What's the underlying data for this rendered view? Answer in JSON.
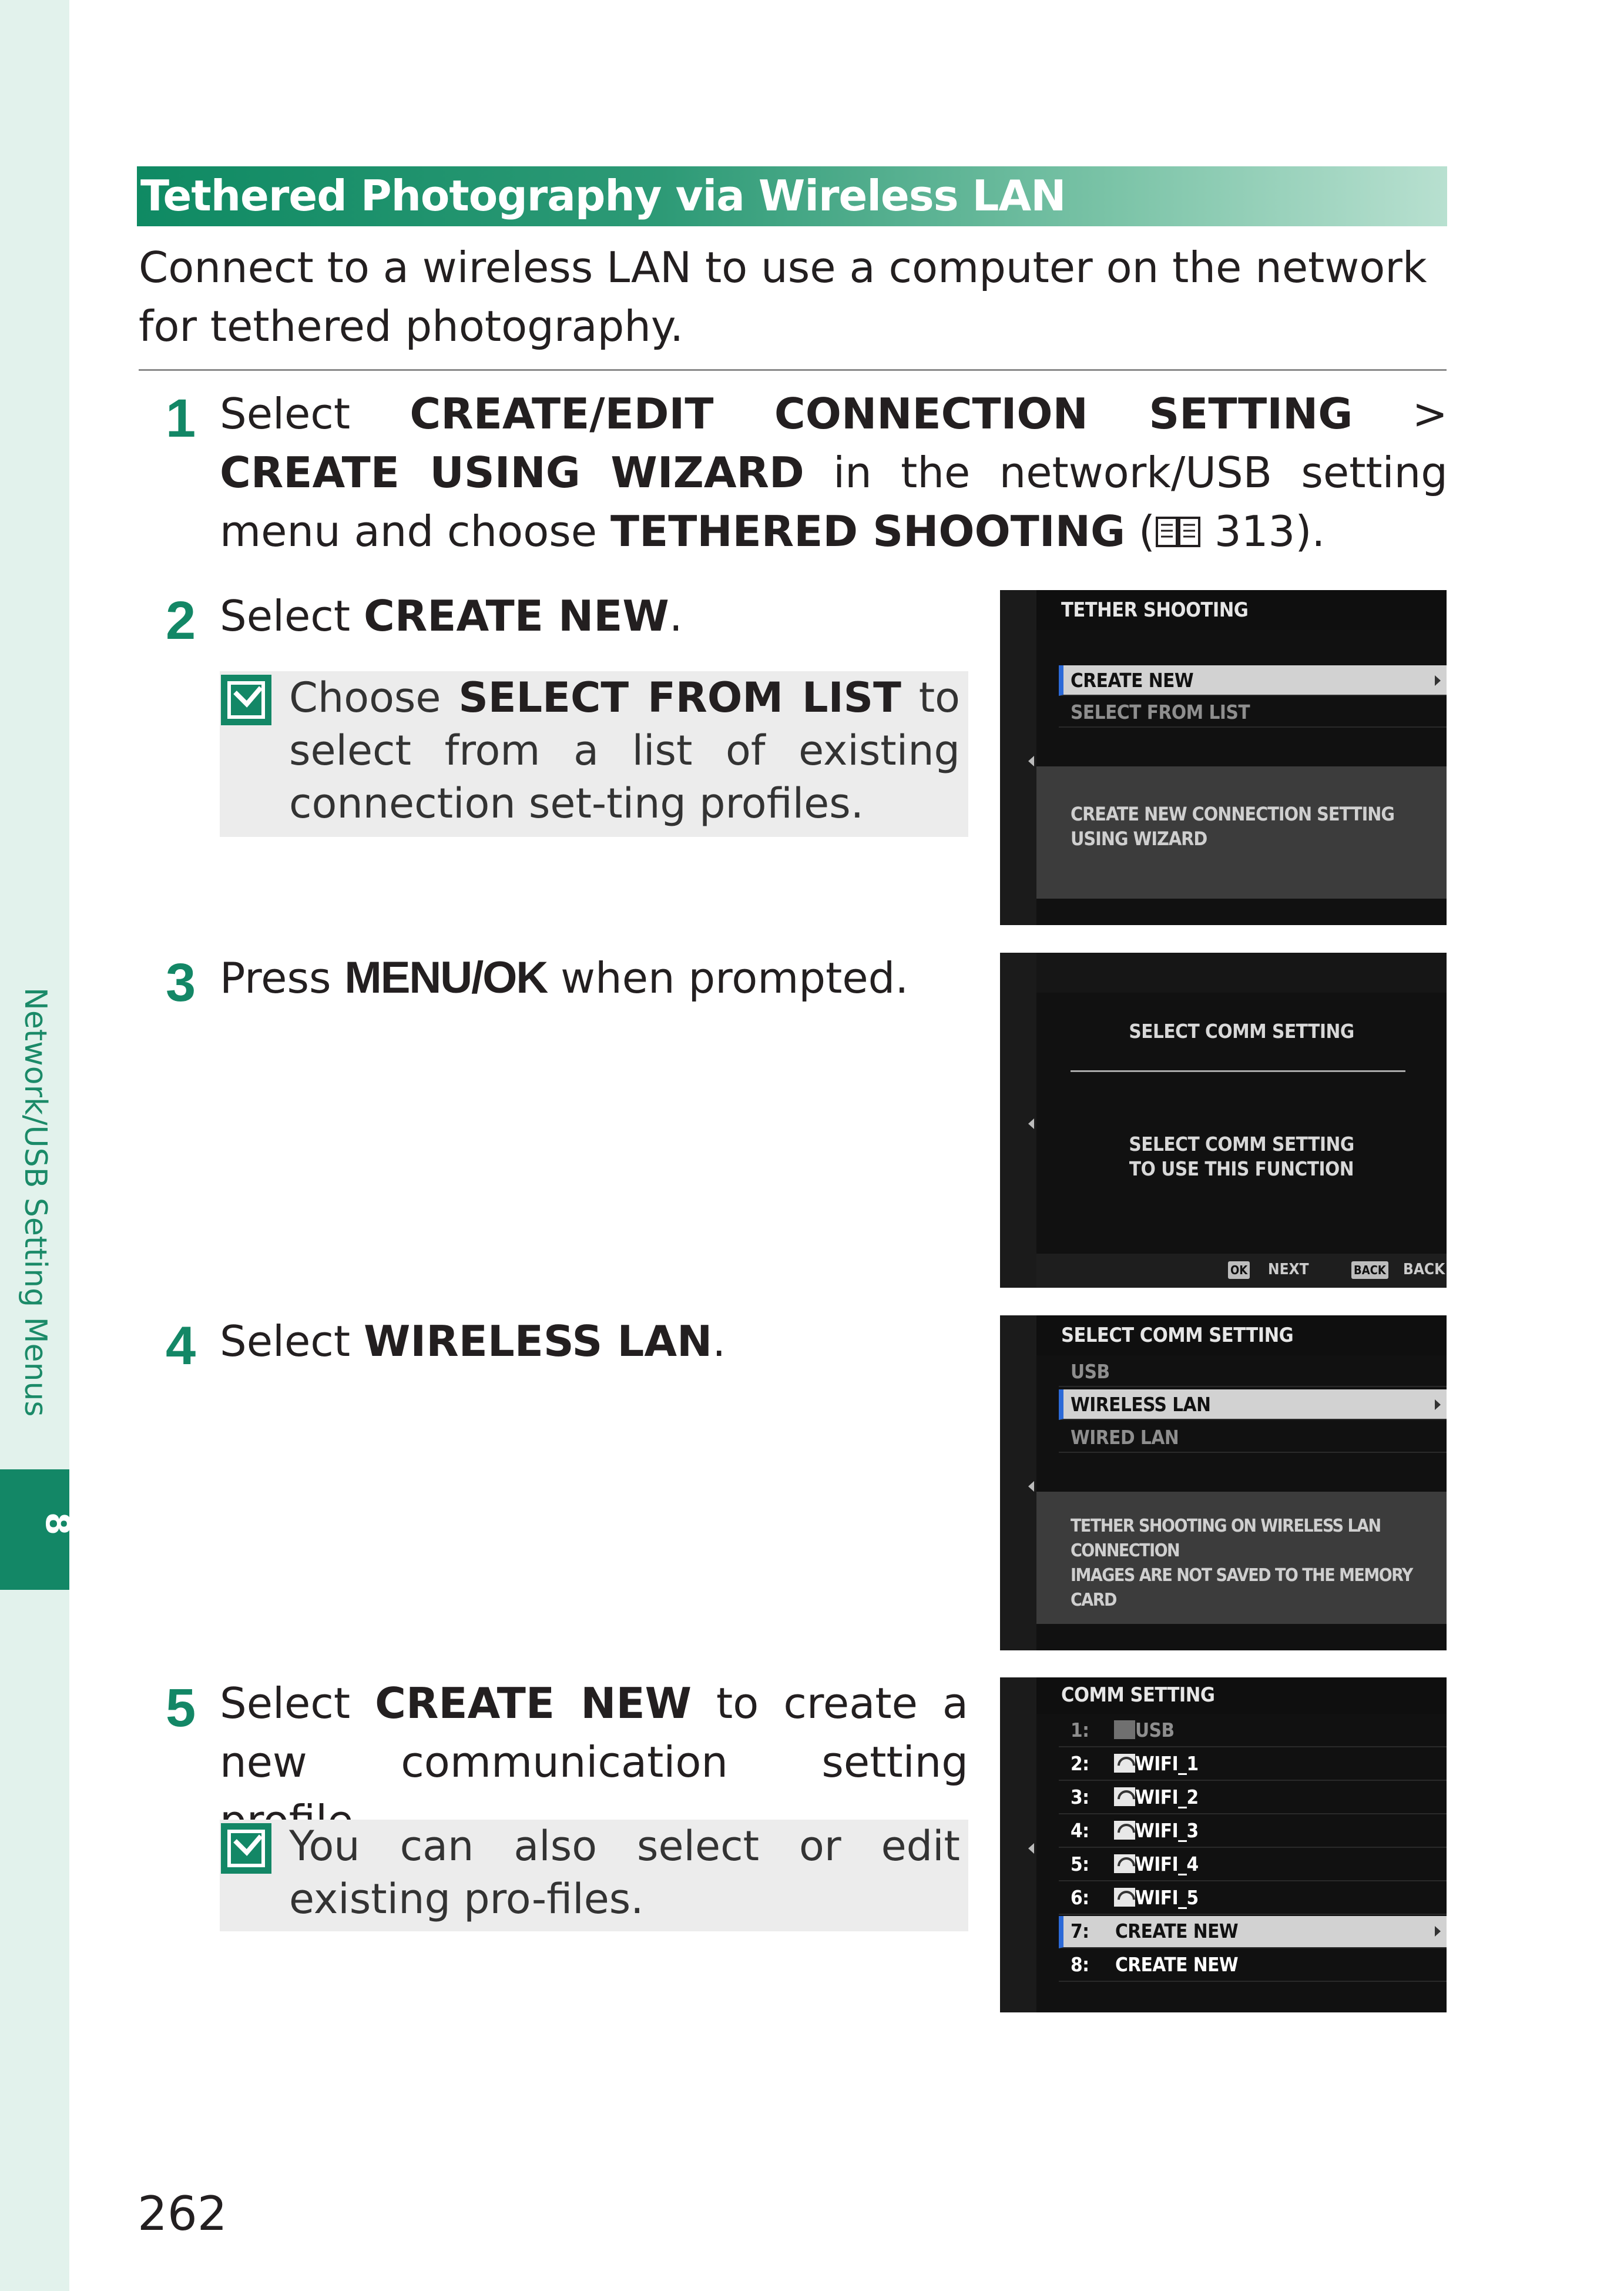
{
  "sidebar": {
    "chapter_label": "Network/USB Setting Menus",
    "chapter_number": "8"
  },
  "section": {
    "title": "Tethered Photography via Wireless LAN",
    "intro": "Connect to a wireless LAN to use a computer on the network for tethered photography."
  },
  "steps": {
    "s1": {
      "num": "1",
      "t1": "Select ",
      "b1": "CREATE/EDIT CONNECTION SETTING",
      "t2": " > ",
      "b2": "CREATE USING WIZARD",
      "t3": " in the network/USB setting menu and choose ",
      "b3": "TETHERED SHOOTING",
      "t4": " (",
      "t5": " 313)."
    },
    "s2": {
      "num": "2",
      "t1": "Select ",
      "b1": "CREATE NEW",
      "t2": "."
    },
    "s2_note": {
      "t1": "Choose ",
      "b1": "SELECT FROM LIST",
      "t2": " to select from a list of existing connection set-ting profiles."
    },
    "s3": {
      "num": "3",
      "t1": "Press ",
      "b1": "MENU/OK",
      "t2": " when prompted."
    },
    "s4": {
      "num": "4",
      "t1": "Select ",
      "b1": "WIRELESS LAN",
      "t2": "."
    },
    "s5": {
      "num": "5",
      "t1": "Select ",
      "b1": "CREATE NEW",
      "t2": " to create a new communication setting profile."
    },
    "s5_note": {
      "text": "You can also select or edit existing pro-files."
    }
  },
  "screens": {
    "scr1": {
      "title": "TETHER SHOOTING",
      "rows": [
        "CREATE NEW",
        "SELECT FROM LIST"
      ],
      "desc1": "CREATE NEW CONNECTION SETTING",
      "desc2": "USING WIZARD"
    },
    "scr2": {
      "title": "SELECT COMM SETTING",
      "msg1": "SELECT COMM SETTING",
      "msg2": "TO USE THIS FUNCTION",
      "ok_btn": "OK",
      "next": "NEXT",
      "back_btn": "BACK",
      "back": "BACK"
    },
    "scr3": {
      "title": "SELECT COMM SETTING",
      "rows": [
        "USB",
        "WIRELESS LAN",
        "WIRED LAN"
      ],
      "desc1": "TETHER SHOOTING ON WIRELESS LAN CONNECTION",
      "desc2": "IMAGES ARE NOT SAVED TO THE MEMORY CARD"
    },
    "scr4": {
      "title": "COMM SETTING",
      "rows": [
        {
          "n": "1:",
          "label": "USB"
        },
        {
          "n": "2:",
          "label": "WIFI_1"
        },
        {
          "n": "3:",
          "label": "WIFI_2"
        },
        {
          "n": "4:",
          "label": "WIFI_3"
        },
        {
          "n": "5:",
          "label": "WIFI_4"
        },
        {
          "n": "6:",
          "label": "WIFI_5"
        },
        {
          "n": "7:",
          "label": "CREATE NEW"
        },
        {
          "n": "8:",
          "label": "CREATE NEW"
        }
      ]
    }
  },
  "footer": {
    "page_number": "262"
  },
  "colors": {
    "accent_green": "#138766",
    "header_gradient_end": "#b8e0d0",
    "highlight_blue": "#2c6ad8"
  }
}
